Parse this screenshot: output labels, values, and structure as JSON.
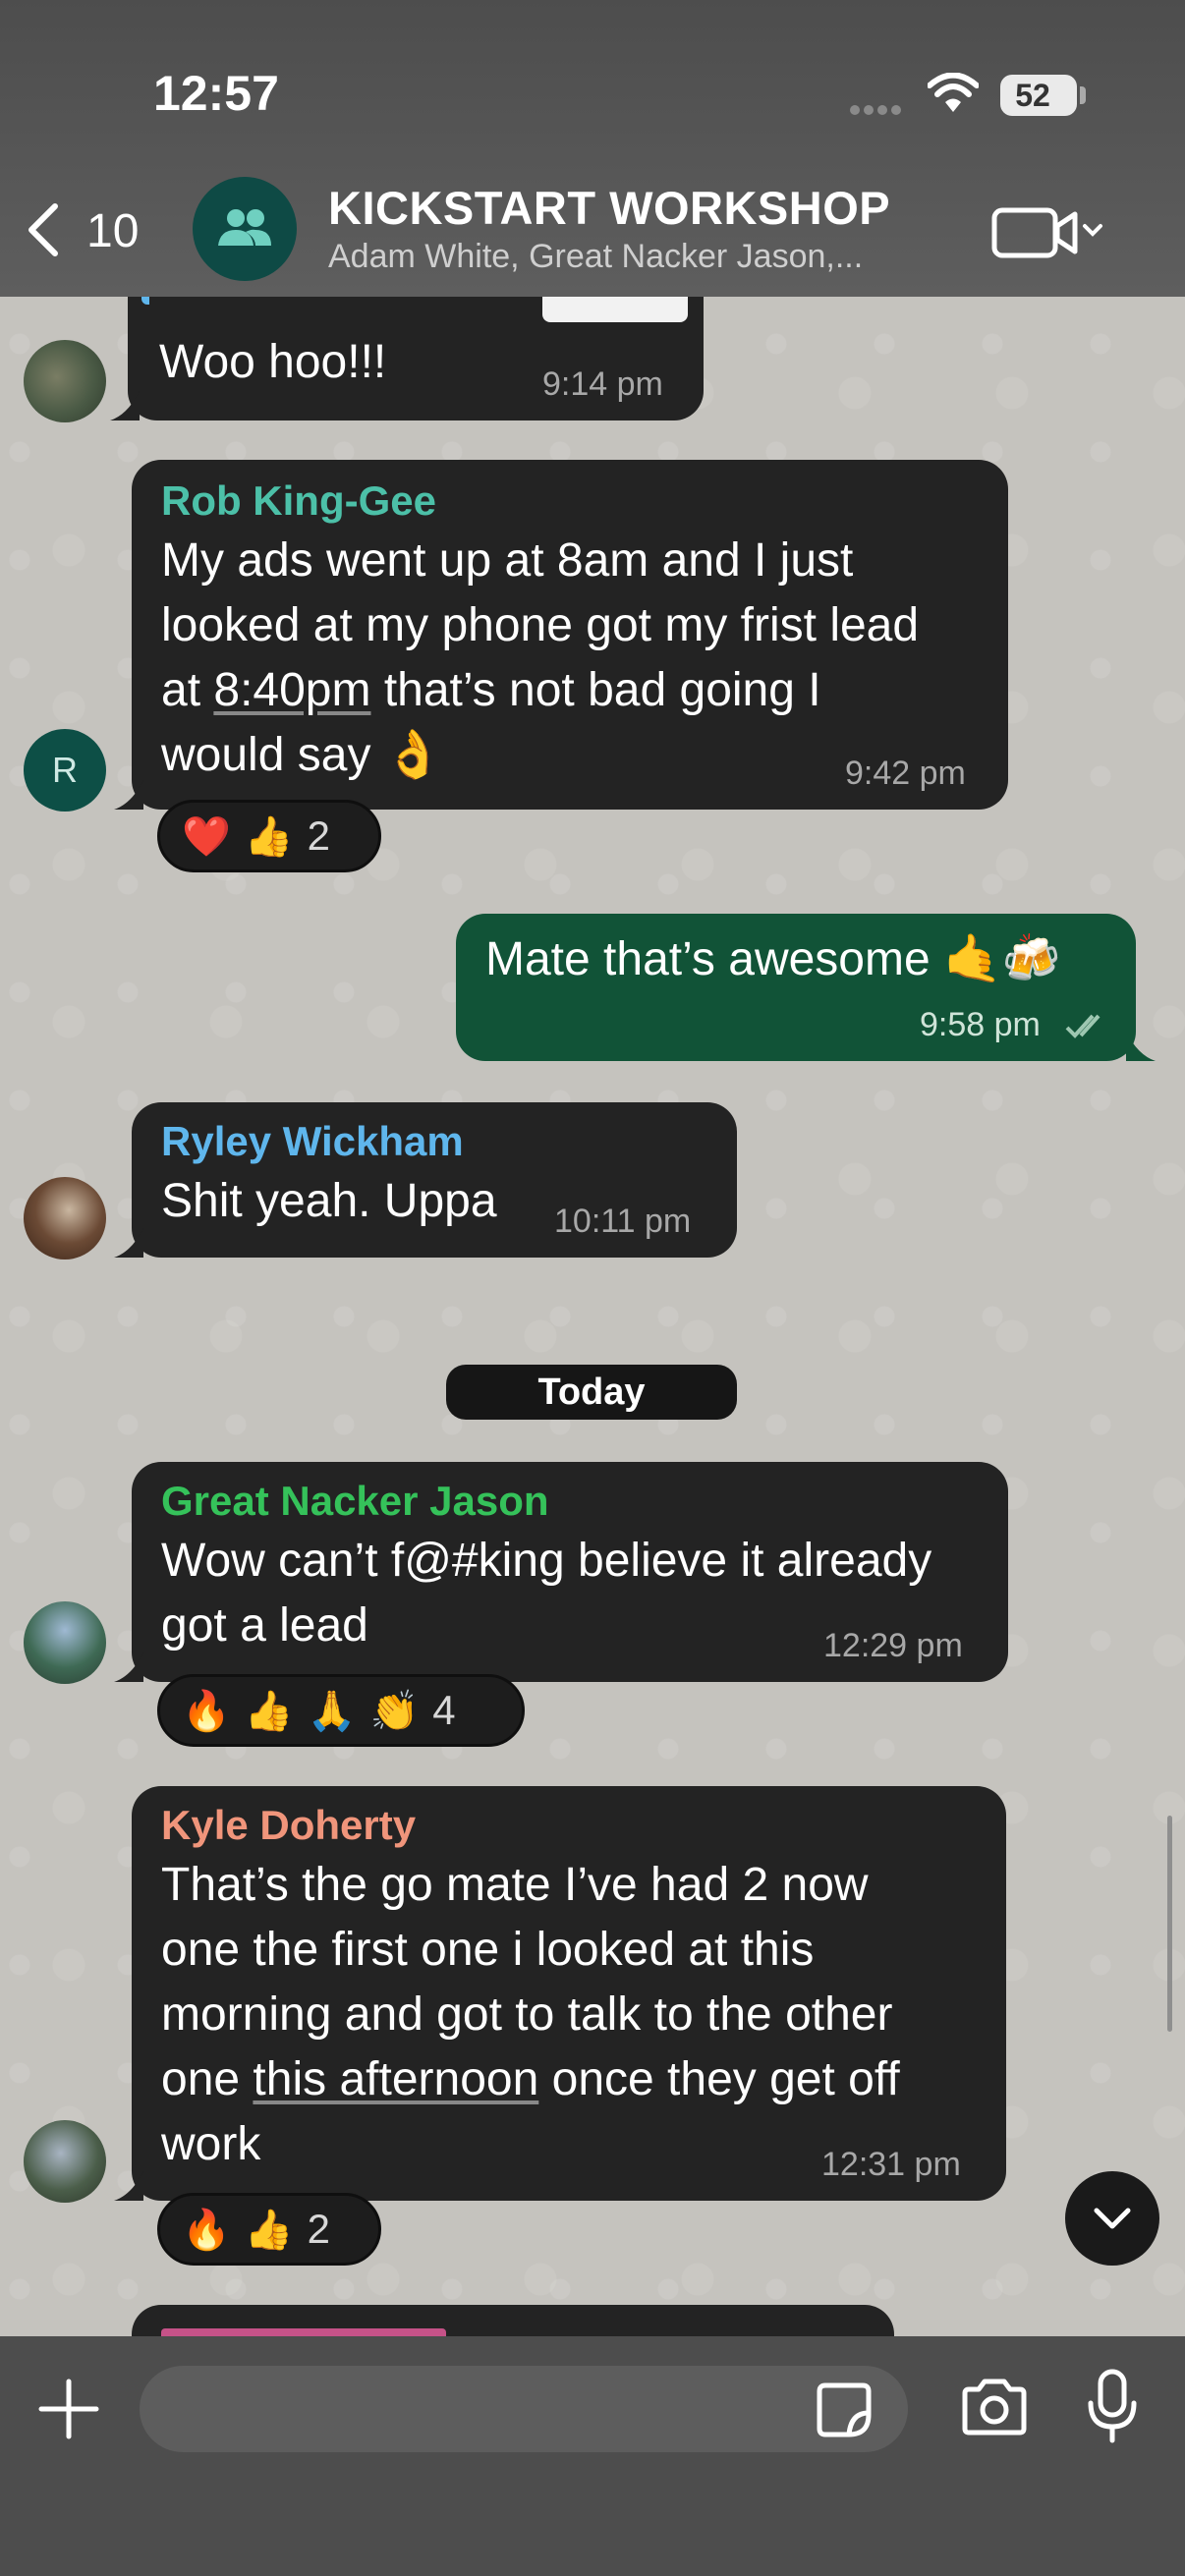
{
  "status_bar": {
    "time": "12:57",
    "battery": "52"
  },
  "header": {
    "back_count": "10",
    "title": "KICKSTART WORKSHOP",
    "subtitle": "Adam White, Great Nacker Jason,..."
  },
  "messages": [
    {
      "text": "Woo hoo!!!",
      "time": "9:14 pm"
    },
    {
      "sender": "Rob King-Gee",
      "sender_color": "#4cc0a8",
      "avatar_letter": "R",
      "lines": [
        "My ads went up at 8am and I just",
        "looked at my phone got my frist lead",
        "at ",
        "8:40pm",
        " that’s not bad going I",
        "would say 👌"
      ],
      "time": "9:42 pm",
      "reactions": {
        "emojis": [
          "❤️",
          "👍"
        ],
        "count": "2"
      }
    },
    {
      "text": "Mate that’s awesome 🤙🍻",
      "time": "9:58 pm",
      "outgoing": true
    },
    {
      "sender": "Ryley Wickham",
      "sender_color": "#5fb6ec",
      "text": "Shit yeah. Uppa",
      "time": "10:11 pm"
    },
    {
      "sender": "Great Nacker Jason",
      "sender_color": "#35c25a",
      "lines": [
        "Wow can’t f@#king believe it already",
        "got a lead"
      ],
      "time": "12:29 pm",
      "reactions": {
        "emojis": [
          "🔥",
          "👍",
          "🙏",
          "👏"
        ],
        "count": "4"
      }
    },
    {
      "sender": "Kyle Doherty",
      "sender_color": "#f0957b",
      "lines": [
        "That’s the go mate I’ve had 2 now",
        "one the first one i looked at this",
        "morning and got to talk to the other",
        "one ",
        "this afternoon",
        " once they get off",
        "work"
      ],
      "time": "12:31 pm",
      "reactions": {
        "emojis": [
          "🔥",
          "👍"
        ],
        "count": "2"
      }
    }
  ],
  "date_separator": "Today",
  "input": {
    "placeholder": ""
  },
  "colors": {
    "incoming_bubble": "#232323",
    "outgoing_bubble": "#115337",
    "header": "#555555"
  }
}
